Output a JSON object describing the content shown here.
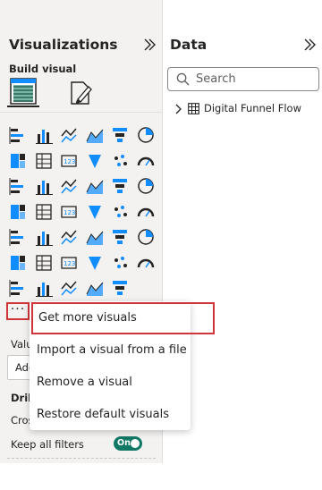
{
  "visualizations": {
    "title": "Visualizations",
    "build_label": "Build visual",
    "tabs": [
      {
        "name": "build-visual-tab",
        "icon": "bar-table-icon",
        "selected": true
      },
      {
        "name": "format-visual-tab",
        "icon": "paint-brush-icon",
        "selected": false
      }
    ],
    "more_label": "···"
  },
  "fields": {
    "values_label": "Valu",
    "add_label": "Add",
    "drill_label": "Dril",
    "cross_label": "Cros",
    "keep_filters_label": "Keep all filters",
    "toggle_label": "On",
    "toggle_on": true
  },
  "data": {
    "title": "Data",
    "search_placeholder": "Search",
    "tables": [
      {
        "label": "Digital Funnel Flow",
        "expanded": false
      }
    ]
  },
  "context_menu": {
    "items": [
      {
        "label": "Get more visuals",
        "highlighted": true
      },
      {
        "label": "Import a visual from a file",
        "highlighted": false
      },
      {
        "label": "Remove a visual",
        "highlighted": false
      },
      {
        "label": "Restore default visuals",
        "highlighted": false
      }
    ]
  },
  "colors": {
    "accent_red": "#d13438",
    "toggle_green": "#117865",
    "icon_blue": "#118dff",
    "icon_dark": "#252423"
  },
  "visual_icons": [
    "stacked-bar-icon",
    "stacked-column-icon",
    "clustered-bar-icon",
    "clustered-column-icon",
    "100-stacked-bar-icon",
    "100-stacked-column-icon",
    "line-chart-icon",
    "area-chart-icon",
    "stacked-area-icon",
    "line-column-icon",
    "line-clustered-column-icon",
    "ribbon-chart-icon",
    "waterfall-icon",
    "funnel-icon",
    "scatter-icon",
    "pie-icon",
    "donut-icon",
    "treemap-icon",
    "map-icon",
    "filled-map-icon",
    "azure-map-icon",
    "gauge-icon",
    "card-icon",
    "multi-row-card-icon",
    "kpi-icon",
    "slicer-icon",
    "table-icon",
    "matrix-icon",
    "r-visual-icon",
    "python-visual-icon",
    "key-influencers-icon",
    "decomposition-tree-icon",
    "qa-icon",
    "narrative-icon",
    "goals-icon",
    "paginated-report-icon",
    "new-card-icon",
    "button-slicer-icon",
    "power-apps-icon",
    "power-automate-icon",
    "chevron-flow-icon"
  ]
}
